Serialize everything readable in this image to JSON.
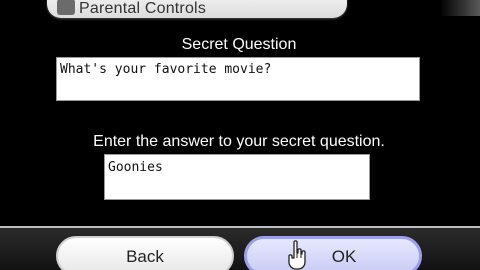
{
  "header": {
    "title": "Parental Controls",
    "icon": "parental-controls-icon"
  },
  "secret_question": {
    "label": "Secret Question",
    "value": "What's your favorite movie?"
  },
  "answer": {
    "label": "Enter the answer to your secret question.",
    "value": "Goonies"
  },
  "buttons": {
    "back_label": "Back",
    "ok_label": "OK"
  },
  "cursor": {
    "icon": "hand-pointer-icon"
  },
  "colors": {
    "background": "#000000",
    "ok_accent": "#9aa0ee"
  }
}
